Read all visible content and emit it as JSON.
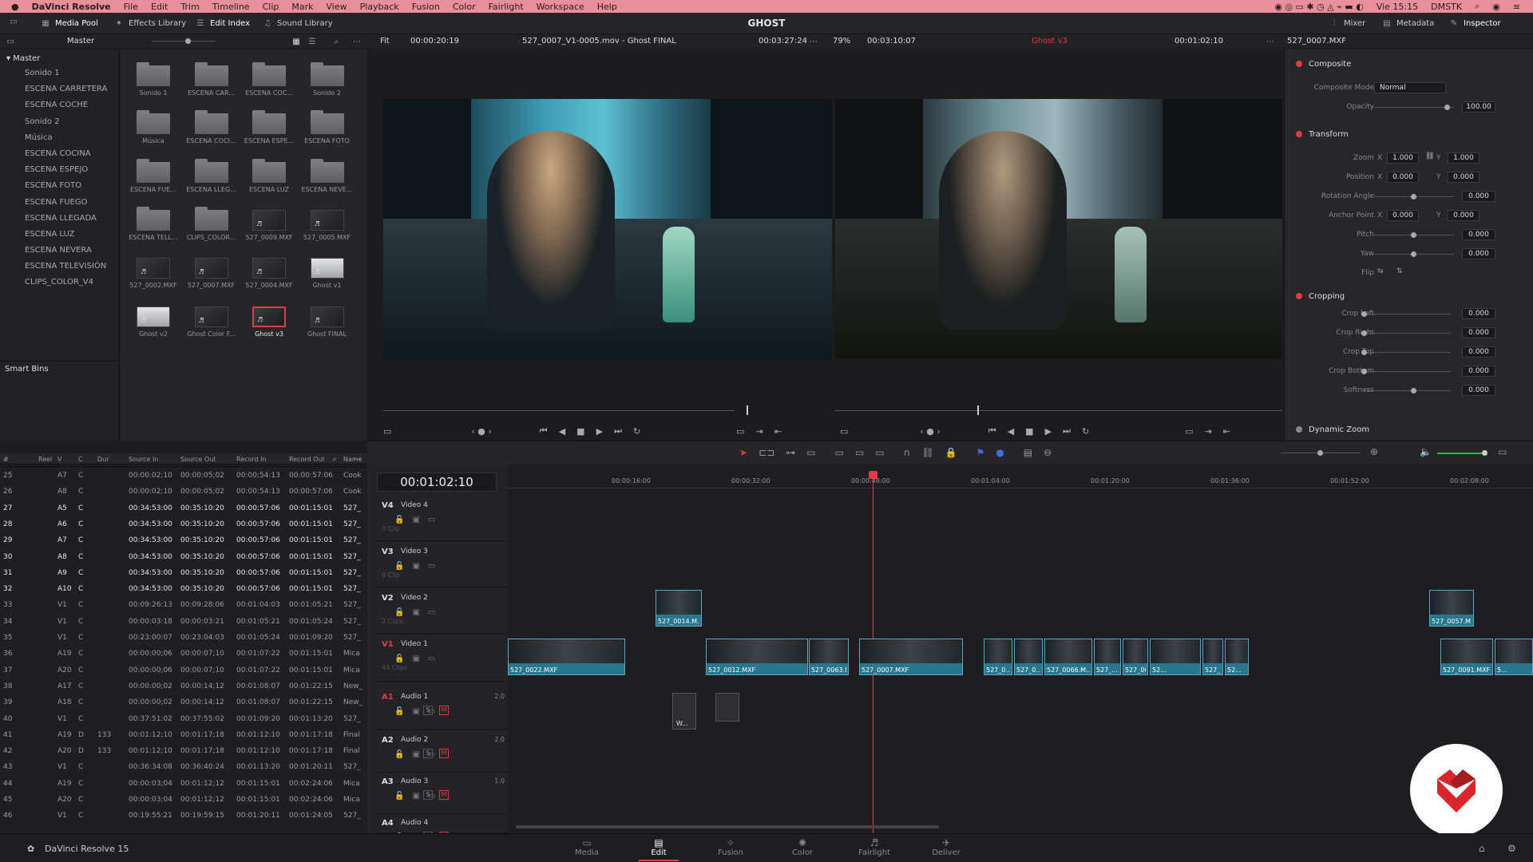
{
  "macbar": {
    "apple": "",
    "app": "DaVinci Resolve",
    "menus": [
      "File",
      "Edit",
      "Trim",
      "Timeline",
      "Clip",
      "Mark",
      "View",
      "Playback",
      "Fusion",
      "Color",
      "Fairlight",
      "Workspace",
      "Help"
    ],
    "clock": "Vie 15:15",
    "user": "DMSTK"
  },
  "titlebar": {
    "project_title": "GHOST",
    "left_buttons": [
      {
        "label": "Media Pool",
        "icon": "media-pool-icon"
      },
      {
        "label": "Effects Library",
        "icon": "effects-icon"
      },
      {
        "label": "Edit Index",
        "icon": "list-icon"
      },
      {
        "label": "Sound Library",
        "icon": "sound-icon"
      }
    ],
    "right_buttons": [
      {
        "label": "Mixer",
        "icon": "mixer-icon"
      },
      {
        "label": "Metadata",
        "icon": "metadata-icon"
      },
      {
        "label": "Inspector",
        "icon": "inspector-icon"
      }
    ]
  },
  "media_pool": {
    "header": "Master",
    "root_bin": "Master",
    "bins": [
      "Sonido 1",
      "ESCENA CARRETERA",
      "ESCENA COCHE",
      "Sonido 2",
      "Música",
      "ESCENA COCINA",
      "ESCENA ESPEJO",
      "ESCENA FOTO",
      "ESCENA FUEGO",
      "ESCENA LLEGADA",
      "ESCENA LUZ",
      "ESCENA NEVERA",
      "ESCENA TELEVISIÓN",
      "CLIPS_COLOR_V4"
    ],
    "smart_bins": "Smart Bins",
    "tiles": [
      {
        "label": "Sonido 1",
        "kind": "folder"
      },
      {
        "label": "ESCENA CAR...",
        "kind": "folder"
      },
      {
        "label": "ESCENA COC...",
        "kind": "folder"
      },
      {
        "label": "Sonido 2",
        "kind": "folder"
      },
      {
        "label": "Música",
        "kind": "folder"
      },
      {
        "label": "ESCENA COCI...",
        "kind": "folder"
      },
      {
        "label": "ESCENA ESPE...",
        "kind": "folder"
      },
      {
        "label": "ESCENA FOTO",
        "kind": "folder"
      },
      {
        "label": "ESCENA FUE...",
        "kind": "folder"
      },
      {
        "label": "ESCENA LLEG...",
        "kind": "folder"
      },
      {
        "label": "ESCENA LUZ",
        "kind": "folder"
      },
      {
        "label": "ESCENA NEVE...",
        "kind": "folder"
      },
      {
        "label": "ESCENA TELL...",
        "kind": "folder"
      },
      {
        "label": "CLIPS_COLOR...",
        "kind": "folder"
      },
      {
        "label": "527_0009.MXF",
        "kind": "clip"
      },
      {
        "label": "527_0005.MXF",
        "kind": "clip"
      },
      {
        "label": "527_0002.MXF",
        "kind": "clip"
      },
      {
        "label": "527_0007.MXF",
        "kind": "clip"
      },
      {
        "label": "527_0004.MXF",
        "kind": "clip"
      },
      {
        "label": "Ghost v1",
        "kind": "light"
      },
      {
        "label": "Ghost v2",
        "kind": "light"
      },
      {
        "label": "Ghost Color F...",
        "kind": "clip"
      },
      {
        "label": "Ghost v3",
        "kind": "selected"
      },
      {
        "label": "Ghost FINAL",
        "kind": "clip"
      }
    ]
  },
  "edl": {
    "columns": [
      "#",
      "Reel",
      "V",
      "C",
      "Dur",
      "Source In",
      "Source Out",
      "Record In",
      "Record Out",
      "Name"
    ],
    "rows": [
      [
        "25",
        "",
        "A7",
        "C",
        "",
        "00:00:02;10",
        "00:00:05;02",
        "00:00:54:13",
        "00:00:57:06",
        "Cook"
      ],
      [
        "26",
        "",
        "A8",
        "C",
        "",
        "00:00:02;10",
        "00:00:05;02",
        "00:00:54:13",
        "00:00:57:06",
        "Cook"
      ],
      [
        "27",
        "",
        "A5",
        "C",
        "",
        "00:34:53:00",
        "00:35:10:20",
        "00:00:57:06",
        "00:01:15:01",
        "527_"
      ],
      [
        "28",
        "",
        "A6",
        "C",
        "",
        "00:34:53:00",
        "00:35:10:20",
        "00:00:57:06",
        "00:01:15:01",
        "527_"
      ],
      [
        "29",
        "",
        "A7",
        "C",
        "",
        "00:34:53:00",
        "00:35:10:20",
        "00:00:57:06",
        "00:01:15:01",
        "527_"
      ],
      [
        "30",
        "",
        "A8",
        "C",
        "",
        "00:34:53:00",
        "00:35:10:20",
        "00:00:57:06",
        "00:01:15:01",
        "527_"
      ],
      [
        "31",
        "",
        "A9",
        "C",
        "",
        "00:34:53:00",
        "00:35:10:20",
        "00:00:57:06",
        "00:01:15:01",
        "527_"
      ],
      [
        "32",
        "",
        "A10",
        "C",
        "",
        "00:34:53:00",
        "00:35:10:20",
        "00:00:57:06",
        "00:01:15:01",
        "527_"
      ],
      [
        "33",
        "",
        "V1",
        "C",
        "",
        "00:09:26:13",
        "00:09:28:06",
        "00:01:04:03",
        "00:01:05:21",
        "527_"
      ],
      [
        "34",
        "",
        "V1",
        "C",
        "",
        "00:00:03:18",
        "00:00:03:21",
        "00:01:05:21",
        "00:01:05:24",
        "527_"
      ],
      [
        "35",
        "",
        "V1",
        "C",
        "",
        "00:23:00:07",
        "00:23:04:03",
        "00:01:05:24",
        "00:01:09:20",
        "527_"
      ],
      [
        "36",
        "",
        "A19",
        "C",
        "",
        "00:00:00;06",
        "00:00:07;10",
        "00:01:07:22",
        "00:01:15:01",
        "Mica"
      ],
      [
        "37",
        "",
        "A20",
        "C",
        "",
        "00:00:00;06",
        "00:00:07;10",
        "00:01:07:22",
        "00:01:15:01",
        "Mica"
      ],
      [
        "38",
        "",
        "A17",
        "C",
        "",
        "00:00:00;02",
        "00:00:14;12",
        "00:01:08:07",
        "00:01:22:15",
        "New_"
      ],
      [
        "39",
        "",
        "A18",
        "C",
        "",
        "00:00:00;02",
        "00:00:14;12",
        "00:01:08:07",
        "00:01:22:15",
        "New_"
      ],
      [
        "40",
        "",
        "V1",
        "C",
        "",
        "00:37:51:02",
        "00:37:55:02",
        "00:01:09:20",
        "00:01:13:20",
        "527_"
      ],
      [
        "41",
        "",
        "A19",
        "D",
        "133",
        "00:01:12;10",
        "00:01:17;18",
        "00:01:12:10",
        "00:01:17:18",
        "Final"
      ],
      [
        "42",
        "",
        "A20",
        "D",
        "133",
        "00:01:12;10",
        "00:01:17;18",
        "00:01:12:10",
        "00:01:17:18",
        "Final"
      ],
      [
        "43",
        "",
        "V1",
        "C",
        "",
        "00:36:34:08",
        "00:36:40:24",
        "00:01:13:20",
        "00:01:20:11",
        "527_"
      ],
      [
        "44",
        "",
        "A19",
        "C",
        "",
        "00:00:03;04",
        "00:01:12;12",
        "00:01:15:01",
        "00:02:24:06",
        "Mica"
      ],
      [
        "45",
        "",
        "A20",
        "C",
        "",
        "00:00:03;04",
        "00:01:12;12",
        "00:01:15:01",
        "00:02:24:06",
        "Mica"
      ],
      [
        "46",
        "",
        "V1",
        "C",
        "",
        "00:19:55:21",
        "00:19:59:15",
        "00:01:20:11",
        "00:01:24:05",
        "527_"
      ]
    ]
  },
  "source_viewer": {
    "fit": "Fit",
    "timecode_dur": "00:00:20:19",
    "clip_name": "527_0007_V1-0005.mov - Ghost FINAL",
    "timecode": "00:03:27:24"
  },
  "program_viewer": {
    "zoom": "79%",
    "timecode_dur": "00:03:10:07",
    "timeline_name": "Ghost v3",
    "timecode": "00:01:02:10"
  },
  "inspector": {
    "clip": "527_0007.MXF",
    "composite": {
      "title": "Composite",
      "mode_label": "Composite Mode",
      "mode_value": "Normal",
      "opacity_label": "Opacity",
      "opacity_value": "100.00"
    },
    "transform": {
      "title": "Transform",
      "zoom_label": "Zoom",
      "zoom_x": "1.000",
      "zoom_y": "1.000",
      "position_label": "Position",
      "pos_x": "0.000",
      "pos_y": "0.000",
      "rotation_label": "Rotation Angle",
      "rotation_value": "0.000",
      "anchor_label": "Anchor Point",
      "anchor_x": "0.000",
      "anchor_y": "0.000",
      "pitch_label": "Pitch",
      "pitch_value": "0.000",
      "yaw_label": "Yaw",
      "yaw_value": "0.000",
      "flip_label": "Flip",
      "x_letter": "X",
      "y_letter": "Y"
    },
    "cropping": {
      "title": "Cropping",
      "crop_left_label": "Crop Left",
      "crop_left": "0.000",
      "crop_right_label": "Crop Right",
      "crop_right": "0.000",
      "crop_top_label": "Crop Top",
      "crop_top": "0.000",
      "crop_bottom_label": "Crop Bottom",
      "crop_bottom": "0.000",
      "softness_label": "Softness",
      "softness": "0.000"
    },
    "dynamic_zoom": "Dynamic Zoom"
  },
  "timeline": {
    "timecode": "00:01:02:10",
    "ruler": [
      "00:00:16:00",
      "00:00:32:00",
      "00:00:48:00",
      "00:01:04:00",
      "00:01:20:00",
      "00:01:36:00",
      "00:01:52:00",
      "00:02:08:00"
    ],
    "playhead_fraction": 0.356,
    "tracks": [
      {
        "id": "V4",
        "name": "Video 4",
        "sub": "0 Clip"
      },
      {
        "id": "V3",
        "name": "Video 3",
        "sub": "0 Clip"
      },
      {
        "id": "V2",
        "name": "Video 2",
        "sub": "2 Clips"
      },
      {
        "id": "V1",
        "name": "Video 1",
        "sub": "44 Clips"
      },
      {
        "id": "A1",
        "name": "Audio 1",
        "level": "2.0"
      },
      {
        "id": "A2",
        "name": "Audio 2",
        "level": "2.0"
      },
      {
        "id": "A3",
        "name": "Audio 3",
        "level": "1.0"
      },
      {
        "id": "A4",
        "name": "Audio 4",
        "level": ""
      }
    ],
    "v2_clips": [
      "527_0014.M...",
      "527_0057.M..."
    ],
    "v1_clips": [
      "527_0022.MXF",
      "527_0012.MXF",
      "527_0063.MXF",
      "527_0007.MXF",
      "527_0...",
      "527_0...",
      "527_0066.M...",
      "527_...",
      "527_0040.M...",
      "52...",
      "527_...",
      "52...",
      "527_0091.MXF",
      "5..."
    ],
    "audio_clips": [
      "W..."
    ],
    "solo": "S",
    "mute": "M"
  },
  "pagebar": {
    "app_label": "DaVinci Resolve 15",
    "pages": [
      {
        "label": "Media",
        "icon": "media-page-icon"
      },
      {
        "label": "Edit",
        "icon": "edit-page-icon",
        "active": true
      },
      {
        "label": "Fusion",
        "icon": "fusion-page-icon"
      },
      {
        "label": "Color",
        "icon": "color-page-icon"
      },
      {
        "label": "Fairlight",
        "icon": "fairlight-page-icon"
      },
      {
        "label": "Deliver",
        "icon": "deliver-page-icon"
      }
    ]
  },
  "colors": {
    "accent_red": "#e23b44",
    "clip_blue": "#29778f",
    "macbar_pink": "#e88f9c"
  }
}
